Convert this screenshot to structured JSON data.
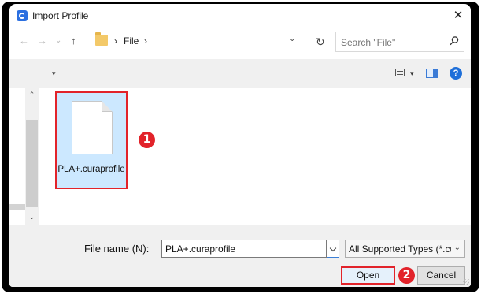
{
  "dialog": {
    "title": "Import Profile"
  },
  "nav": {
    "back_glyph": "←",
    "forward_glyph": "→",
    "recent_glyph": "⌄",
    "up_glyph": "↑",
    "breadcrumb": [
      "File"
    ],
    "separator": "›",
    "refresh_glyph": "↻"
  },
  "search": {
    "placeholder": "Search \"File\""
  },
  "toolbar": {
    "organize_glyph": "▾",
    "view_glyph": "▾",
    "help_glyph": "?"
  },
  "files": [
    {
      "name": "PLA+.curaprofile",
      "selected": true
    }
  ],
  "annotations": [
    {
      "label": "1"
    },
    {
      "label": "2"
    }
  ],
  "footer": {
    "filename_label": "File name (N):",
    "filename_value": "PLA+.curaprofile",
    "filetype_value": "All Supported Types (*.curaprofile)",
    "open_label": "Open",
    "cancel_label": "Cancel"
  },
  "colors": {
    "highlight": "#e2232a",
    "selection": "#cce8ff",
    "accent": "#1e6fd9"
  }
}
